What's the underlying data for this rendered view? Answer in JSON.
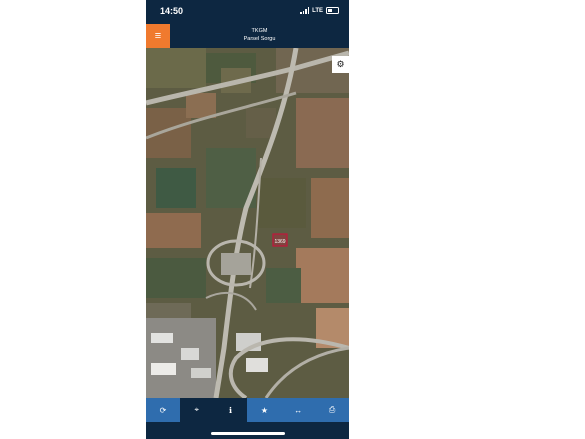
{
  "status_bar": {
    "time": "14:50",
    "network": "LTE"
  },
  "header": {
    "menu_icon": "hamburger-menu-icon",
    "title": "TKGM",
    "subtitle": "Parsel Sorgu"
  },
  "map": {
    "settings_icon": "gear-icon",
    "parcel_label": "1369"
  },
  "toolbar": {
    "buttons": [
      {
        "name": "refresh",
        "icon": "refresh-icon",
        "glyph": "⟳"
      },
      {
        "name": "locate",
        "icon": "crosshair-icon",
        "glyph": "⌖"
      },
      {
        "name": "info",
        "icon": "info-icon",
        "glyph": "ℹ"
      },
      {
        "name": "favorites",
        "icon": "star-icon",
        "glyph": "★"
      },
      {
        "name": "measure",
        "icon": "arrows-horizontal-icon",
        "glyph": "↔"
      },
      {
        "name": "print",
        "icon": "print-icon",
        "glyph": "⎙"
      }
    ]
  },
  "colors": {
    "accent": "#f07a2e",
    "navy": "#0d2741",
    "toolbar_blue": "#2f6dae",
    "parcel": "#c0173a"
  }
}
